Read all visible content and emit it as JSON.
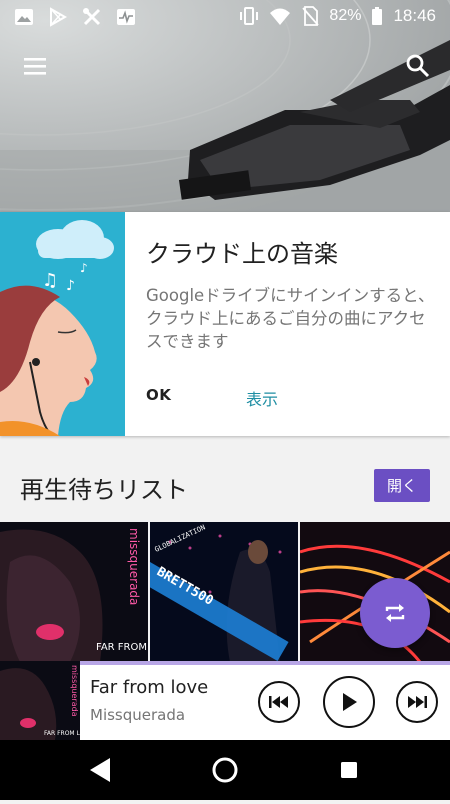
{
  "status_bar": {
    "battery": "82%",
    "time": "18:46"
  },
  "toolbar": {
    "menu_icon": "hamburger-menu-icon",
    "search_icon": "search-icon"
  },
  "card": {
    "title": "クラウド上の音楽",
    "body": "Googleドライブにサインインすると、クラウド上にあるご自分の曲にアクセスできます",
    "ok_label": "OK",
    "show_label": "表示"
  },
  "queue": {
    "title": "再生待ちリスト",
    "open_label": "開く"
  },
  "album_art": {
    "far_from_love": "FAR FROM LOVE",
    "missquerada": "missquerada",
    "globalization": "GLOBALIZATION",
    "brett": "BRETT500"
  },
  "now_playing": {
    "title": "Far from love",
    "artist": "Missquerada"
  },
  "colors": {
    "accent": "#6b4fc3",
    "fab": "#7b5cd0",
    "card_illustration": "#2cb1d0",
    "link": "#1f8ea3"
  }
}
